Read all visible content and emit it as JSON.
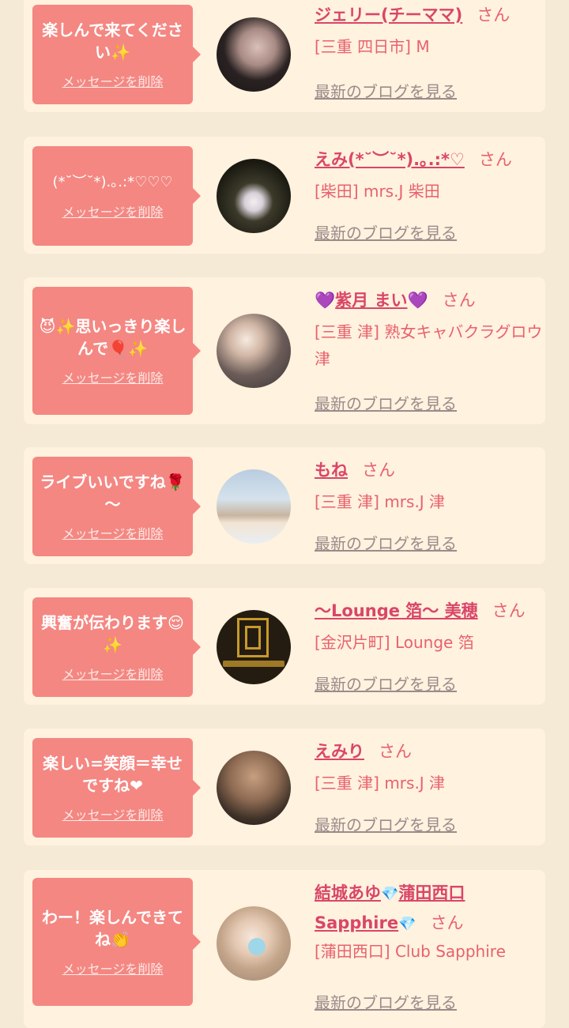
{
  "common": {
    "delete_label": "メッセージを削除",
    "blog_label": "最新のブログを見る",
    "san": "さん"
  },
  "entries": [
    {
      "message": "楽しんで来てください✨",
      "name": "ジェリー(チーママ)",
      "shop": "[三重 四日市] M"
    },
    {
      "message": "(*˘︶˘*).｡.:*♡♡♡",
      "name": "えみ(*˘︶˘*).｡.:*♡",
      "shop": "[柴田] mrs.J 柴田"
    },
    {
      "message": "😈✨思いっきり楽しんで🎈✨",
      "name_a": "💜",
      "name_b": "紫月 まい",
      "name_c": "💜",
      "shop": "[三重 津] 熟女キャバクラグロウ 津"
    },
    {
      "message": "ライブいいですね🌹～",
      "name": "もね",
      "shop": "[三重 津] mrs.J 津"
    },
    {
      "message": "興奮が伝わります😌✨",
      "name": "〜Lounge 箔〜 美穂",
      "shop": "[金沢片町] Lounge 箔"
    },
    {
      "message": "楽しい=笑顔＝幸せですね❤",
      "name": "えみり",
      "shop": "[三重 津] mrs.J 津"
    },
    {
      "message": "わー！楽しんできてね👏",
      "name_a": "結城あゆ",
      "name_b": "💎",
      "name_c": "蒲田西口",
      "name_d": "Sapphire",
      "name_e": "💎",
      "shop": "[蒲田西口] Club Sapphire"
    }
  ]
}
